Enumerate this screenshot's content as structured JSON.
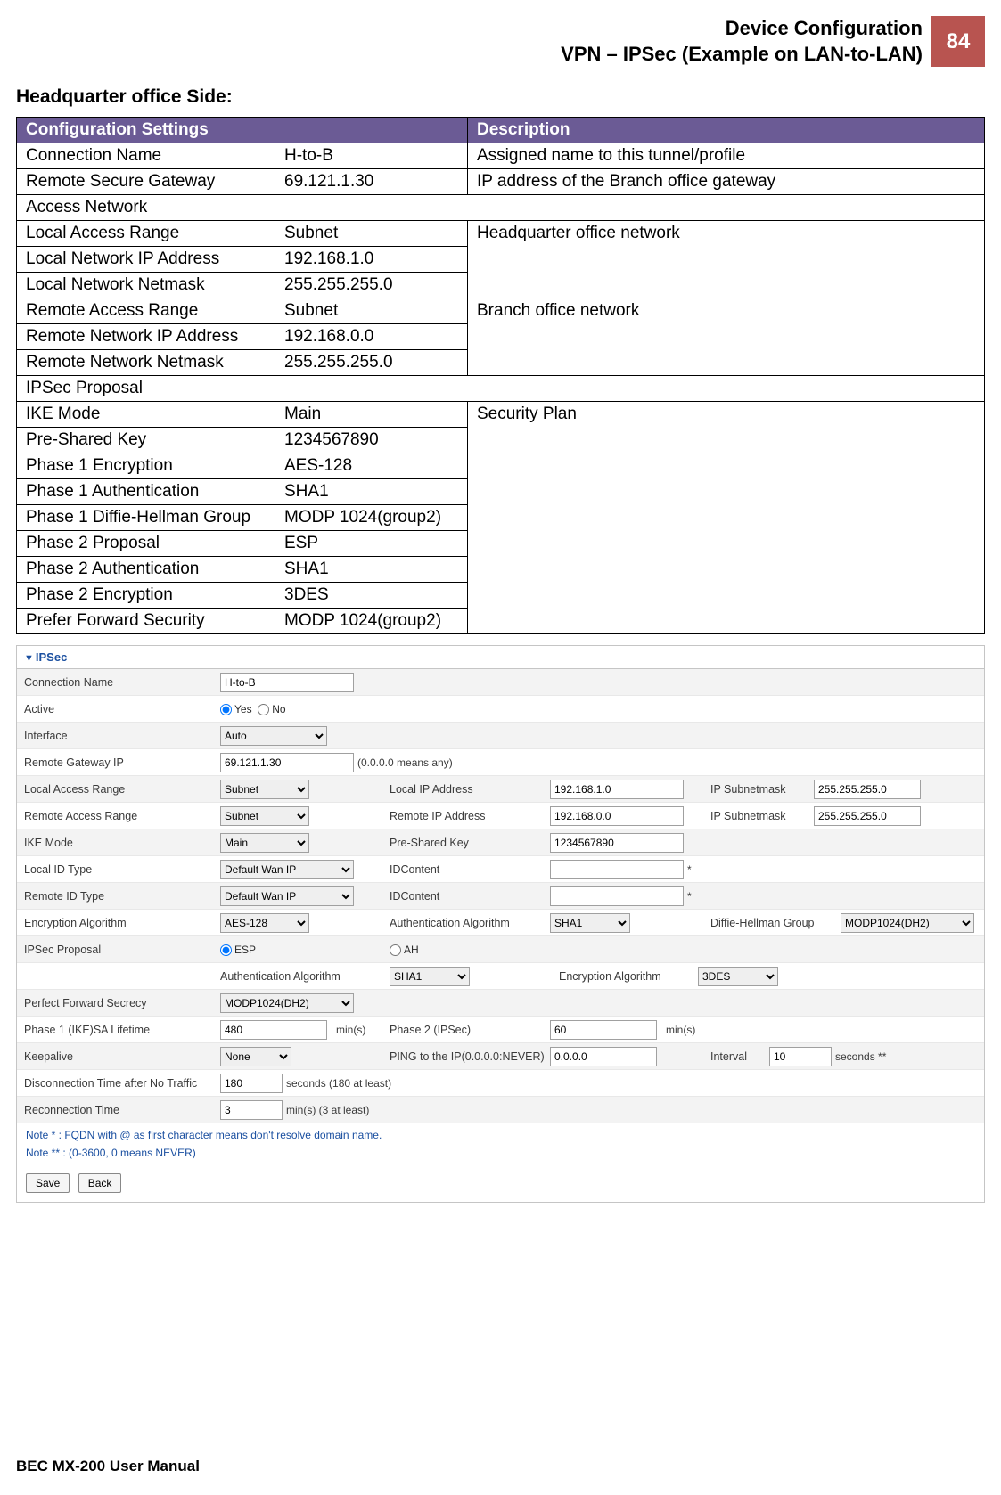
{
  "header": {
    "title_line1": "Device Configuration",
    "title_line2": "VPN – IPSec (Example on LAN-to-LAN)",
    "page_number": "84"
  },
  "section_title": "Headquarter office Side:",
  "config_headers": {
    "c1": "Configuration Settings",
    "c2": "Description"
  },
  "config_rows": [
    {
      "k": "Connection Name",
      "v": "H-to-B",
      "d": "Assigned name to this tunnel/profile",
      "span": 1
    },
    {
      "k": "Remote Secure Gateway",
      "v": "69.121.1.30",
      "d": "IP address of the Branch office gateway",
      "span": 1
    },
    {
      "section": "Access Network"
    },
    {
      "k": "Local Access Range",
      "v": "Subnet",
      "d": "Headquarter office network",
      "span": 3
    },
    {
      "k": "Local Network IP Address",
      "v": "192.168.1.0"
    },
    {
      "k": "Local Network Netmask",
      "v": "255.255.255.0"
    },
    {
      "k": "Remote Access Range",
      "v": "Subnet",
      "d": "Branch office network",
      "span": 3
    },
    {
      "k": "Remote Network IP Address",
      "v": "192.168.0.0"
    },
    {
      "k": "Remote Network Netmask",
      "v": "255.255.255.0"
    },
    {
      "section": "IPSec Proposal"
    },
    {
      "k": "IKE Mode",
      "v": "Main",
      "d": "Security Plan",
      "span": 9
    },
    {
      "k": "Pre-Shared Key",
      "v": "1234567890"
    },
    {
      "k": "Phase 1 Encryption",
      "v": "AES-128"
    },
    {
      "k": "Phase 1 Authentication",
      "v": "SHA1"
    },
    {
      "k": "Phase 1 Diffie-Hellman Group",
      "v": "MODP 1024(group2)"
    },
    {
      "k": "Phase 2 Proposal",
      "v": "ESP"
    },
    {
      "k": "Phase 2 Authentication",
      "v": "SHA1"
    },
    {
      "k": "Phase 2 Encryption",
      "v": "3DES"
    },
    {
      "k": "Prefer Forward Security",
      "v": "MODP 1024(group2)"
    }
  ],
  "form": {
    "section_title": "IPSec",
    "labels": {
      "connection_name": "Connection Name",
      "active": "Active",
      "yes": "Yes",
      "no": "No",
      "interface": "Interface",
      "remote_gateway_ip": "Remote Gateway IP",
      "remote_gateway_hint": "(0.0.0.0 means any)",
      "local_access_range": "Local Access Range",
      "local_ip_address": "Local IP Address",
      "ip_subnetmask": "IP Subnetmask",
      "remote_access_range": "Remote Access Range",
      "remote_ip_address": "Remote IP Address",
      "ike_mode": "IKE Mode",
      "pre_shared_key": "Pre-Shared Key",
      "local_id_type": "Local ID Type",
      "idcontent": "IDContent",
      "remote_id_type": "Remote ID Type",
      "encryption_algorithm": "Encryption Algorithm",
      "authentication_algorithm": "Authentication Algorithm",
      "diffie_hellman_group": "Diffie-Hellman Group",
      "ipsec_proposal": "IPSec Proposal",
      "esp": "ESP",
      "ah": "AH",
      "perfect_forward_secrecy": "Perfect Forward Secrecy",
      "phase1_life": "Phase 1 (IKE)SA Lifetime",
      "mins": "min(s)",
      "phase2_ipsec": "Phase 2 (IPSec)",
      "keepalive": "Keepalive",
      "ping_to_ip": "PING to the IP(0.0.0.0:NEVER)",
      "interval": "Interval",
      "seconds_star": "seconds **",
      "disconnect_after": "Disconnection Time after No Traffic",
      "seconds_180": "seconds (180 at least)",
      "reconnection_time": "Reconnection Time",
      "mins_3": "min(s) (3 at least)",
      "save": "Save",
      "back": "Back"
    },
    "values": {
      "connection_name": "H-to-B",
      "active_yes": true,
      "interface": "Auto",
      "remote_gateway_ip": "69.121.1.30",
      "local_access_range": "Subnet",
      "local_ip": "192.168.1.0",
      "local_mask": "255.255.255.0",
      "remote_access_range": "Subnet",
      "remote_ip": "192.168.0.0",
      "remote_mask": "255.255.255.0",
      "ike_mode": "Main",
      "pre_shared_key": "1234567890",
      "local_id_type": "Default Wan IP",
      "local_id_content": "",
      "remote_id_type": "Default Wan IP",
      "remote_id_content": "",
      "enc_alg": "AES-128",
      "auth_alg": "SHA1",
      "dh_group": "MODP1024(DH2)",
      "ipsec_prop_esp": true,
      "auth_alg2": "SHA1",
      "enc_alg2": "3DES",
      "pfs": "MODP1024(DH2)",
      "phase1_life": "480",
      "phase2_life": "60",
      "keepalive": "None",
      "ping_ip": "0.0.0.0",
      "interval": "10",
      "disconnect": "180",
      "reconnect": "3"
    },
    "notes": {
      "n1": "Note * : FQDN with @ as first character means don't resolve domain name.",
      "n2": "Note ** : (0-3600, 0 means NEVER)"
    }
  },
  "footer": "BEC MX-200 User Manual"
}
